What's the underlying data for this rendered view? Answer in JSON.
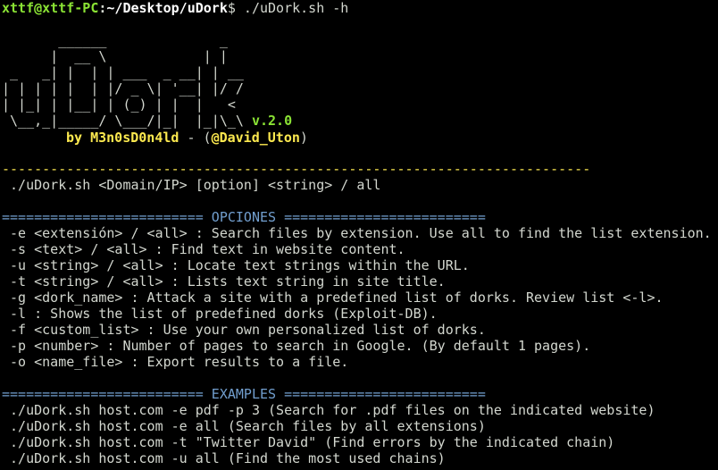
{
  "prompt": {
    "user_host": "xttf@xttf-PC",
    "separator": ":",
    "path": "~/Desktop/uDork",
    "dollar": "$",
    "command": " ./uDork.sh -h"
  },
  "banner": {
    "ascii_lines": [
      "       ______              _",
      "      |  __ \\            | |",
      " _   _| |  | | ___  _ __| | __",
      "| | | | |  | |/ _ \\| '__| |/ /",
      "| |_| | |__| | (_) | |  |   <",
      " \\__,_|_____/ \\___/|_|  |_|\\_\\"
    ],
    "version": "v.2.0",
    "by": "by M3n0sD0n4ld",
    "dash_sep": " - ",
    "handle_open": "(",
    "handle": "@David_Uton",
    "handle_close": ")"
  },
  "usage": {
    "separator": "-------------------------------------------------------------------------",
    "text": " ./uDork.sh <Domain/IP> [option] <string> / all"
  },
  "options": {
    "heading": "========================= OPCIONES =========================",
    "lines": [
      " -e <extensión> / <all> : Search files by extension. Use all to find the list extension.",
      " -s <text> / <all> : Find text in website content.",
      " -u <string> / <all> : Locate text strings within the URL.",
      " -t <string> / <all> : Lists text string in site title.",
      " -g <dork_name> : Attack a site with a predefined list of dorks. Review list <-l>.",
      " -l : Shows the list of predefined dorks (Exploit-DB).",
      " -f <custom_list> : Use your own personalized list of dorks.",
      " -p <number> : Number of pages to search in Google. (By default 1 pages).",
      " -o <name_file> : Export results to a file."
    ]
  },
  "examples": {
    "heading": "========================= EXAMPLES =========================",
    "lines": [
      " ./uDork.sh host.com -e pdf -p 3 (Search for .pdf files on the indicated website)",
      " ./uDork.sh host.com -e all (Search files by all extensions)",
      " ./uDork.sh host.com -t \"Twitter David\" (Find errors by the indicated chain)",
      " ./uDork.sh host.com -u all (Find the most used chains)"
    ]
  },
  "colors": {
    "background": "#000000",
    "prompt_user": "#8ae234",
    "text": "#d3d7cf",
    "yellow": "#fce94f",
    "heading_blue": "#729fcf"
  }
}
